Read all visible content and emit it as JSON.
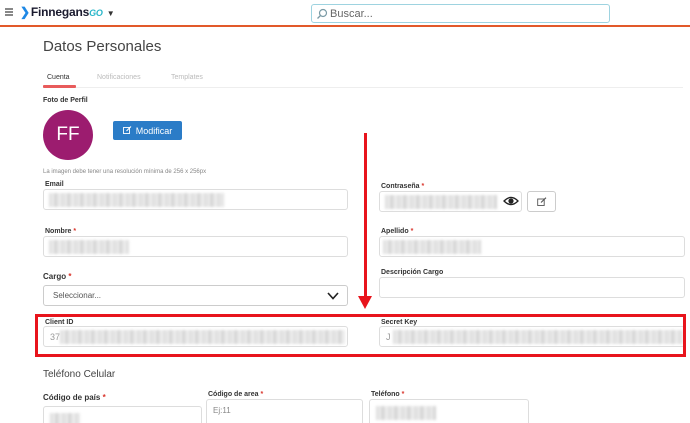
{
  "header": {
    "logo_text": "Finnegans",
    "logo_suffix": "GO",
    "search_placeholder": "Buscar..."
  },
  "page": {
    "title": "Datos Personales"
  },
  "tabs": [
    {
      "label": "Cuenta",
      "active": true
    },
    {
      "label": "Notificaciones",
      "active": false
    },
    {
      "label": "Templates",
      "active": false
    }
  ],
  "profile": {
    "photo_label": "Foto de Perfil",
    "avatar_initials": "FF",
    "avatar_color": "#9c1c6f",
    "modify_button": "Modificar",
    "resolution_hint": "La imagen debe tener una resolución mínima de 256 x 256px"
  },
  "fields": {
    "email_label": "Email",
    "password_label": "Contraseña",
    "nombre_label": "Nombre",
    "apellido_label": "Apellido",
    "cargo_label": "Cargo",
    "cargo_value": "Seleccionar...",
    "descripcion_label": "Descripción Cargo",
    "client_id_label": "Client ID",
    "client_id_prefix": "37",
    "secret_key_label": "Secret Key",
    "secret_key_prefix": "J",
    "required_mark": "*"
  },
  "phone": {
    "section_title": "Teléfono Celular",
    "country_code_label": "Código de país",
    "area_code_label": "Código de area",
    "area_code_placeholder": "Ej:11",
    "phone_label": "Teléfono"
  },
  "colors": {
    "accent": "#e2592a",
    "annotation": "#e8141c",
    "primary_button": "#2b7cc7"
  }
}
